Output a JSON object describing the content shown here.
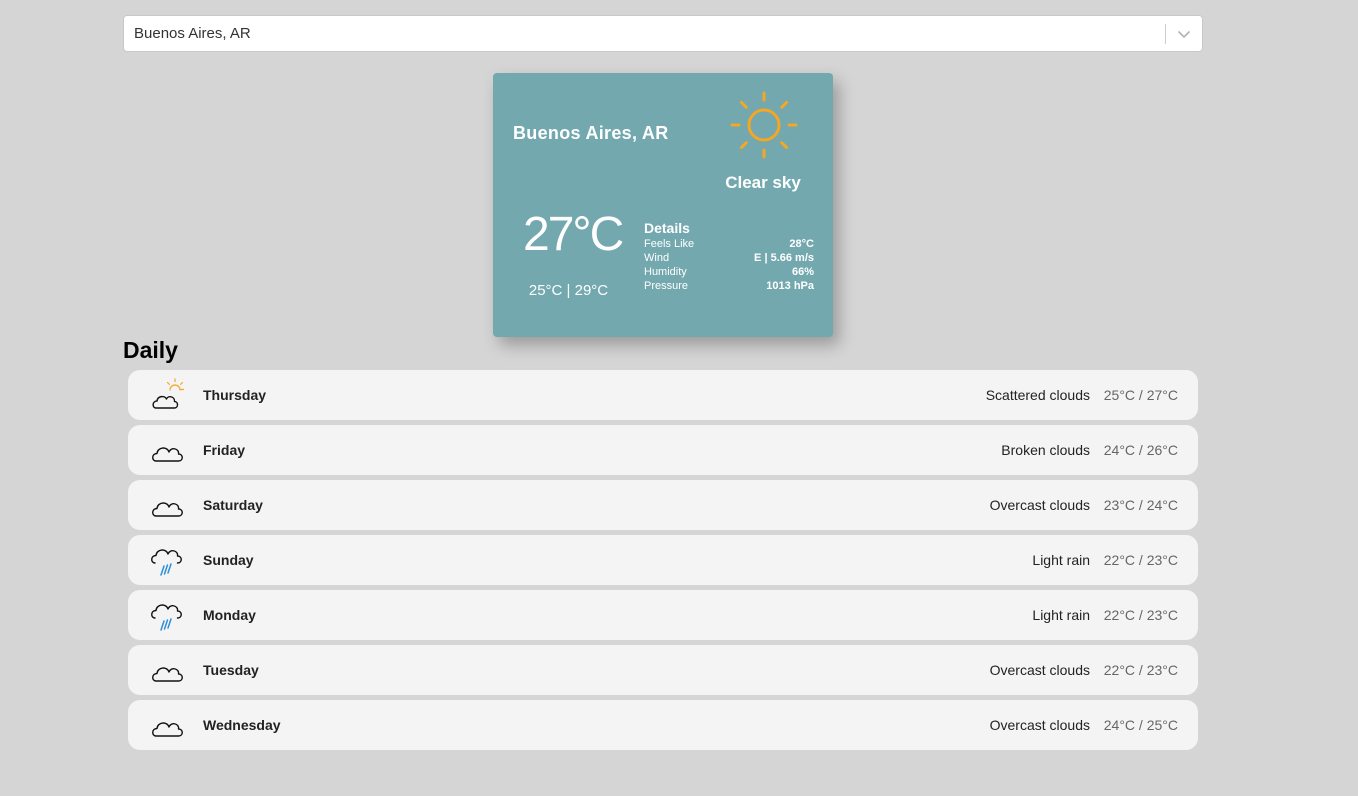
{
  "search": {
    "value": "Buenos Aires, AR"
  },
  "current": {
    "city": "Buenos Aires, AR",
    "icon": "sun-icon",
    "description": "Clear sky",
    "temperature": "27°C",
    "min_max": "25°C | 29°C",
    "details_title": "Details",
    "details": [
      {
        "label": "Feels Like",
        "value": "28°C"
      },
      {
        "label": "Wind",
        "value": "E | 5.66 m/s"
      },
      {
        "label": "Humidity",
        "value": "66%"
      },
      {
        "label": "Pressure",
        "value": "1013 hPa"
      }
    ]
  },
  "daily": {
    "title": "Daily",
    "days": [
      {
        "day": "Thursday",
        "icon": "partly-cloudy-icon",
        "description": "Scattered clouds",
        "temps": "25°C / 27°C"
      },
      {
        "day": "Friday",
        "icon": "cloud-icon",
        "description": "Broken clouds",
        "temps": "24°C / 26°C"
      },
      {
        "day": "Saturday",
        "icon": "cloud-icon",
        "description": "Overcast clouds",
        "temps": "23°C / 24°C"
      },
      {
        "day": "Sunday",
        "icon": "rain-icon",
        "description": "Light rain",
        "temps": "22°C / 23°C"
      },
      {
        "day": "Monday",
        "icon": "rain-icon",
        "description": "Light rain",
        "temps": "22°C / 23°C"
      },
      {
        "day": "Tuesday",
        "icon": "cloud-icon",
        "description": "Overcast clouds",
        "temps": "22°C / 23°C"
      },
      {
        "day": "Wednesday",
        "icon": "cloud-icon",
        "description": "Overcast clouds",
        "temps": "24°C / 25°C"
      }
    ]
  },
  "colors": {
    "page_background": "#d5d5d5",
    "card_background": "#73a8af",
    "sun": "#f5a623",
    "rain": "#2f8fd8",
    "row_background": "#f4f4f4"
  }
}
